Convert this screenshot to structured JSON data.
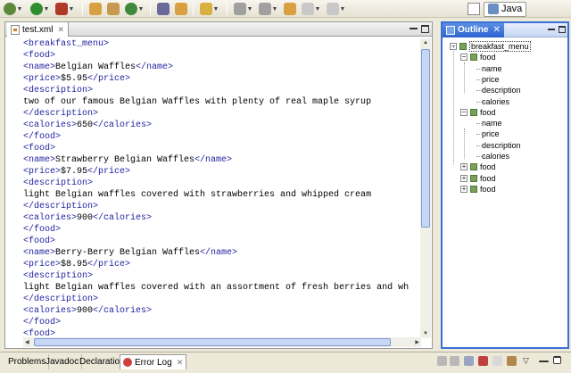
{
  "toolbar": {
    "icons": [
      "debug-icon",
      "run-icon",
      "external-tools-icon",
      "new-project-icon",
      "package-icon",
      "new-class-icon",
      "open-type-icon",
      "search-icon",
      "open-file-icon",
      "next-annotation-icon",
      "previous-annotation-icon",
      "last-edit-icon",
      "back-icon",
      "forward-icon"
    ],
    "colors": {
      "debug": "#5a8a3a",
      "run": "#2f8f2f",
      "external": "#b03a2a",
      "new_project": "#d8a040",
      "package": "#c89850",
      "new_class": "#3f8a3a",
      "open_type": "#6a6a9a",
      "search": "#d8a040",
      "open_file": "#d8b040",
      "nav": "#a0a0a0",
      "last_edit": "#d8a040"
    },
    "perspective_label": "Java"
  },
  "editor": {
    "tab_label": "test.xml",
    "lines": [
      {
        "t": "<breakfast_menu>",
        "k": "tag"
      },
      {
        "t": "<food>",
        "k": "tag"
      },
      {
        "parts": [
          [
            "<name>",
            "tag"
          ],
          [
            "Belgian Waffles",
            "txt"
          ],
          [
            "</name>",
            "tag"
          ]
        ]
      },
      {
        "parts": [
          [
            "<price>",
            "tag"
          ],
          [
            "$5.95",
            "txt"
          ],
          [
            "</price>",
            "tag"
          ]
        ]
      },
      {
        "t": "<description>",
        "k": "tag"
      },
      {
        "t": "two of our famous Belgian Waffles with plenty of real maple syrup",
        "k": "txt"
      },
      {
        "t": "</description>",
        "k": "tag"
      },
      {
        "parts": [
          [
            "<calories>",
            "tag"
          ],
          [
            "650",
            "txt"
          ],
          [
            "</calories>",
            "tag"
          ]
        ]
      },
      {
        "t": "</food>",
        "k": "tag"
      },
      {
        "t": "<food>",
        "k": "tag"
      },
      {
        "parts": [
          [
            "<name>",
            "tag"
          ],
          [
            "Strawberry Belgian Waffles",
            "txt"
          ],
          [
            "</name>",
            "tag"
          ]
        ]
      },
      {
        "parts": [
          [
            "<price>",
            "tag"
          ],
          [
            "$7.95",
            "txt"
          ],
          [
            "</price>",
            "tag"
          ]
        ]
      },
      {
        "t": "<description>",
        "k": "tag"
      },
      {
        "t": "light Belgian waffles covered with strawberries and whipped cream",
        "k": "txt"
      },
      {
        "t": "</description>",
        "k": "tag"
      },
      {
        "parts": [
          [
            "<calories>",
            "tag"
          ],
          [
            "900",
            "txt"
          ],
          [
            "</calories>",
            "tag"
          ]
        ]
      },
      {
        "t": "</food>",
        "k": "tag"
      },
      {
        "t": "<food>",
        "k": "tag"
      },
      {
        "parts": [
          [
            "<name>",
            "tag"
          ],
          [
            "Berry-Berry Belgian Waffles",
            "txt"
          ],
          [
            "</name>",
            "tag"
          ]
        ]
      },
      {
        "parts": [
          [
            "<price>",
            "tag"
          ],
          [
            "$8.95",
            "txt"
          ],
          [
            "</price>",
            "tag"
          ]
        ]
      },
      {
        "t": "<description>",
        "k": "tag"
      },
      {
        "t": "light Belgian waffles covered with an assortment of fresh berries and wh",
        "k": "txt"
      },
      {
        "t": "</description>",
        "k": "tag"
      },
      {
        "parts": [
          [
            "<calories>",
            "tag"
          ],
          [
            "900",
            "txt"
          ],
          [
            "</calories>",
            "tag"
          ]
        ]
      },
      {
        "t": "</food>",
        "k": "tag"
      },
      {
        "t": "<food>",
        "k": "tag"
      }
    ]
  },
  "outline": {
    "tab_label": "Outline",
    "nodes": [
      {
        "label": "breakfast_menu",
        "level": 0,
        "expander": "−",
        "selected": true
      },
      {
        "label": "food",
        "level": 1,
        "expander": "−"
      },
      {
        "label": "name",
        "level": 2
      },
      {
        "label": "price",
        "level": 2
      },
      {
        "label": "description",
        "level": 2
      },
      {
        "label": "calories",
        "level": 2
      },
      {
        "label": "food",
        "level": 1,
        "expander": "−"
      },
      {
        "label": "name",
        "level": 2
      },
      {
        "label": "price",
        "level": 2
      },
      {
        "label": "description",
        "level": 2
      },
      {
        "label": "calories",
        "level": 2
      },
      {
        "label": "food",
        "level": 1,
        "expander": "+"
      },
      {
        "label": "food",
        "level": 1,
        "expander": "+"
      },
      {
        "label": "food",
        "level": 1,
        "expander": "+"
      }
    ]
  },
  "bottom_tabs": [
    {
      "label": "Problems",
      "name": "tab-problems"
    },
    {
      "label": "Javadoc",
      "name": "tab-javadoc"
    },
    {
      "label": "Declaration",
      "name": "tab-declaration"
    },
    {
      "label": "Error Log",
      "name": "tab-error-log",
      "active": true
    }
  ],
  "bottom_icons": [
    "export-log-icon",
    "import-log-icon",
    "clear-log-icon",
    "delete-log-icon",
    "open-log-icon",
    "restore-log-icon",
    "view-menu-icon",
    "minimize-icon",
    "maximize-icon"
  ]
}
